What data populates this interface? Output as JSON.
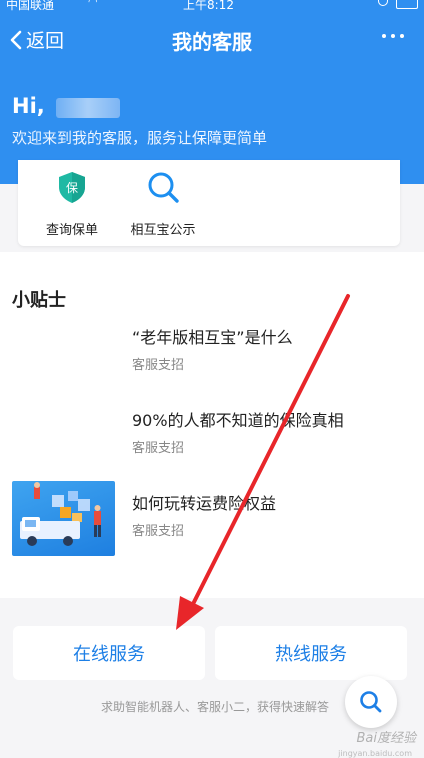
{
  "status_bar": {
    "carrier": "中国联通",
    "time": "上午8:12"
  },
  "nav": {
    "back_label": "返回",
    "title": "我的客服",
    "more_icon": "more-icon"
  },
  "header": {
    "greeting": "Hi,",
    "welcome": "欢迎来到我的客服，服务让保障更简单",
    "bg_color": "#2f8ff0"
  },
  "services": [
    {
      "label": "查询保单",
      "icon": "policy-shield-icon",
      "badge_char": "保"
    },
    {
      "label": "相互宝公示",
      "icon": "search-icon"
    }
  ],
  "tips": {
    "title": "小贴士",
    "items": [
      {
        "title": "“老年版相互宝”是什么",
        "source": "客服支招"
      },
      {
        "title": "90%的人都不知道的保险真相",
        "source": "客服支招"
      },
      {
        "title": "如何玩转运费险权益",
        "source": "客服支招"
      }
    ]
  },
  "actions": {
    "online": "在线服务",
    "hotline": "热线服务",
    "hint": "求助智能机器人、客服小二，获得快速解答"
  },
  "watermark": {
    "main": "Bai度经验",
    "sub": "jingyan.baidu.com"
  },
  "accent_color": "#1d7fe6"
}
